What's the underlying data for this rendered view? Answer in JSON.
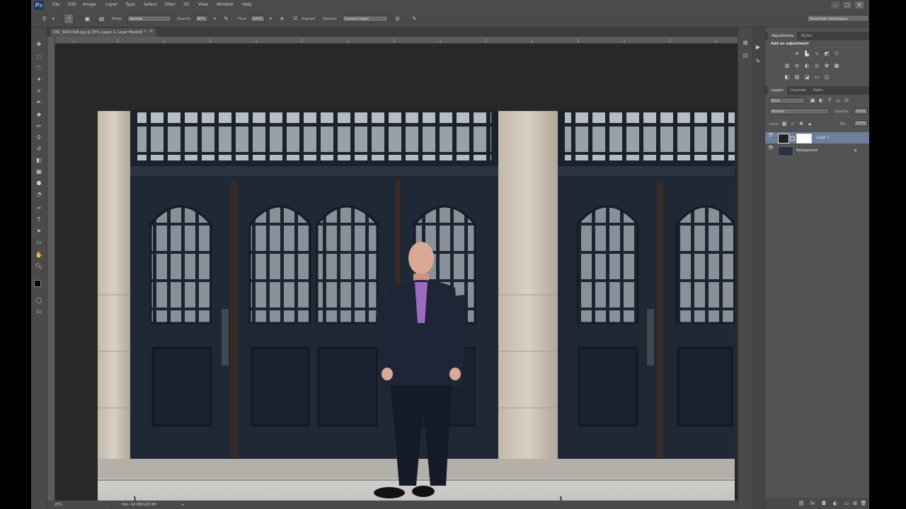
{
  "app": {
    "logo": "Ps",
    "menus": [
      "File",
      "Edit",
      "Image",
      "Layer",
      "Type",
      "Select",
      "Filter",
      "3D",
      "View",
      "Window",
      "Help"
    ]
  },
  "options": {
    "mode_label": "Mode:",
    "mode_value": "Normal",
    "opacity_label": "Opacity:",
    "opacity_value": "80%",
    "flow_label": "Flow:",
    "flow_value": "100%",
    "aligned_label": "Aligned",
    "sample_label": "Sample:",
    "sample_value": "Current Layer",
    "workspace": "Essentials workspace"
  },
  "document": {
    "tab_title": "DSC_6423-Edit.jpg @ 25% (Layer 1, Layer Mask/8) *",
    "zoom": "25%",
    "doc_info": "Doc: 42.8M/128.3M"
  },
  "panels": {
    "adjustments_tab": "Adjustments",
    "styles_tab": "Styles",
    "add_adjustment": "Add an adjustment",
    "layers_tab": "Layers",
    "channels_tab": "Channels",
    "paths_tab": "Paths",
    "kind_filter": "Kind",
    "blend_mode": "Normal",
    "opacity_label": "Opacity:",
    "opacity_value": "100%",
    "lock_label": "Lock:",
    "fill_label": "Fill:",
    "fill_value": "100%",
    "layers": [
      {
        "name": "Layer 1",
        "selected": true
      },
      {
        "name": "Background",
        "selected": false
      }
    ]
  },
  "colors": {
    "ui_bg": "#535353",
    "panel_dark": "#4a4a4a",
    "canvas_bg": "#282828",
    "selected_layer": "#6b7f99"
  }
}
